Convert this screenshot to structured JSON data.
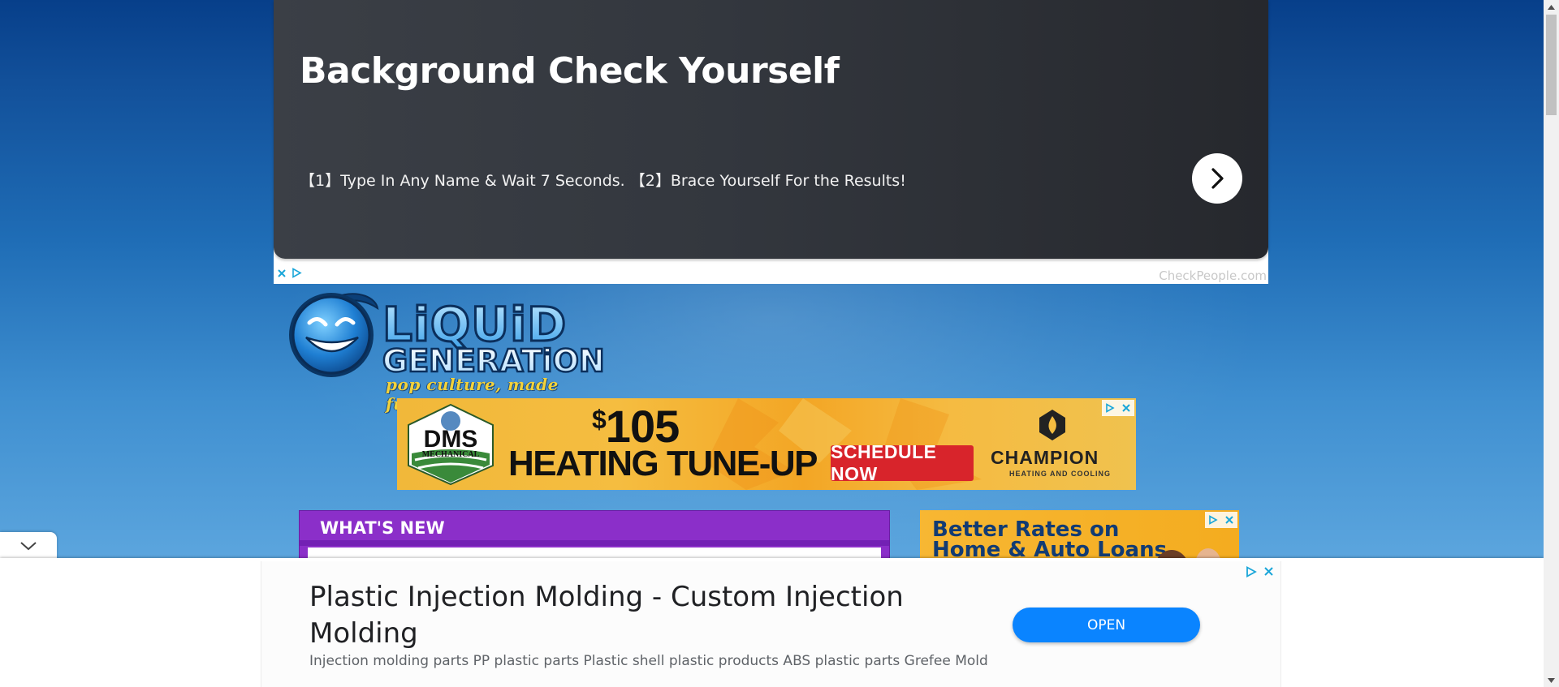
{
  "top_ad": {
    "title": "Background Check Yourself",
    "text": "【1】Type In Any Name & Wait 7 Seconds. 【2】Brace Yourself For the Results!",
    "source": "CheckPeople.com"
  },
  "logo": {
    "line1": "LiQUiD",
    "line2": "GENERATiON",
    "tagline": "pop culture, made funny."
  },
  "banner_ad": {
    "brand_logo_line1": "DMS",
    "brand_logo_line2": "MECHANICAL",
    "price_symbol": "$",
    "price": "105",
    "headline": "HEATING TUNE-UP",
    "button": "SCHEDULE NOW",
    "partner": "CHAMPION",
    "partner_sub": "HEATING AND COOLING"
  },
  "whats_new": {
    "title": "WHAT'S NEW"
  },
  "side_ad": {
    "text_line1": "Better Rates on",
    "text_line2": "Home & Auto Loans"
  },
  "anchor_ad": {
    "title": "Plastic Injection Molding - Custom Injection Molding",
    "description": "Injection molding parts PP plastic parts Plastic shell plastic products ABS plastic parts Grefee Mold",
    "button": "OPEN"
  },
  "colors": {
    "purple": "#8b2fc9",
    "open_blue": "#0a84ff",
    "schedule_red": "#d8242b"
  }
}
